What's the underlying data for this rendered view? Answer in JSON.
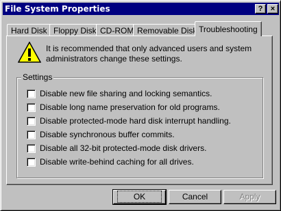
{
  "window": {
    "title": "File System Properties",
    "help_glyph": "?",
    "close_glyph": "×"
  },
  "tabs": [
    {
      "label": "Hard Disk",
      "active": false
    },
    {
      "label": "Floppy Disk",
      "active": false
    },
    {
      "label": "CD-ROM",
      "active": false
    },
    {
      "label": "Removable Disk",
      "active": false
    },
    {
      "label": "Troubleshooting",
      "active": true
    }
  ],
  "warning": {
    "icon": "warning-icon",
    "text": "It is recommended that only advanced users and system administrators change these settings."
  },
  "settings": {
    "label": "Settings",
    "options": [
      {
        "label": "Disable new file sharing and locking semantics.",
        "checked": false
      },
      {
        "label": "Disable long name preservation for old programs.",
        "checked": false
      },
      {
        "label": "Disable protected-mode hard disk interrupt handling.",
        "checked": false
      },
      {
        "label": "Disable synchronous buffer commits.",
        "checked": false
      },
      {
        "label": "Disable all 32-bit protected-mode disk drivers.",
        "checked": false
      },
      {
        "label": "Disable write-behind caching for all drives.",
        "checked": false
      }
    ]
  },
  "buttons": {
    "ok": "OK",
    "cancel": "Cancel",
    "apply": "Apply"
  },
  "colors": {
    "titlebar": "#000080",
    "face": "#c0c0c0",
    "warning_yellow": "#ffff00"
  }
}
